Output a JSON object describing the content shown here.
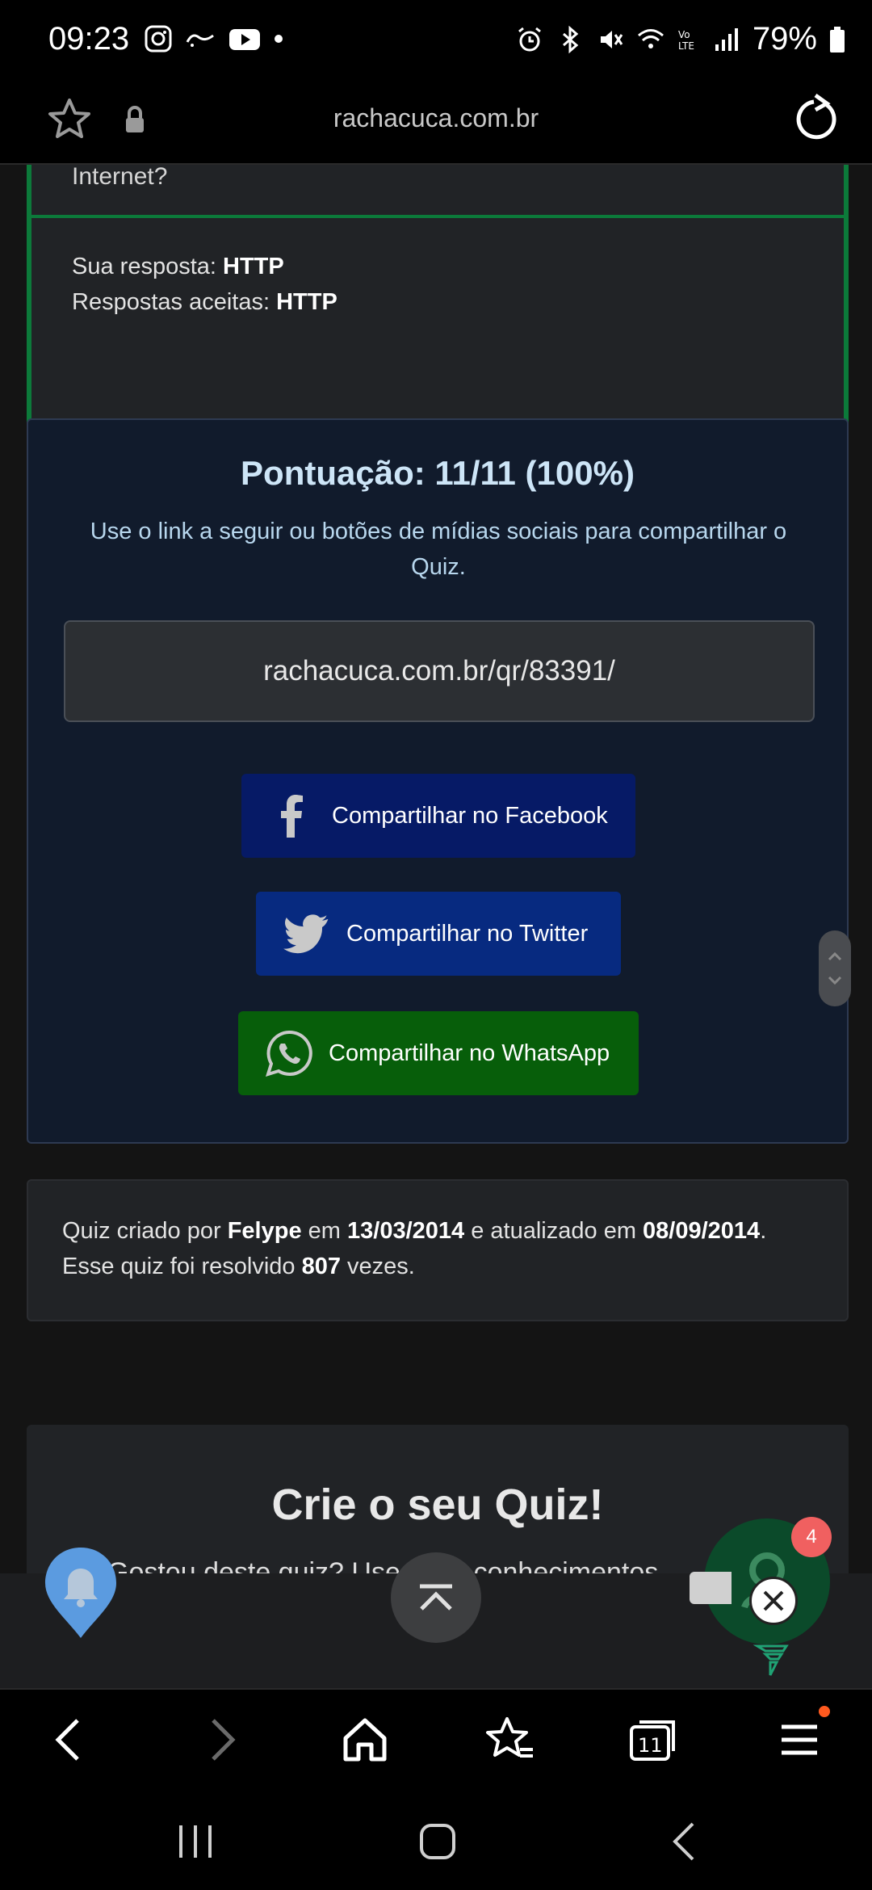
{
  "status_bar": {
    "time": "09:23",
    "battery": "79%",
    "left_icons": [
      "instagram-icon",
      "ifood-icon",
      "youtube-icon",
      "dot-icon"
    ],
    "right_icons": [
      "alarm-icon",
      "bluetooth-icon",
      "mute-icon",
      "wifi-icon",
      "volte-icon",
      "signal-icon",
      "battery-icon"
    ]
  },
  "url_bar": {
    "domain": "rachacuca.com.br"
  },
  "answer": {
    "cut_text": "Internet?",
    "your_answer_label": "Sua resposta:",
    "your_answer_value": "HTTP",
    "accepted_label": "Respostas aceitas:",
    "accepted_value": "HTTP"
  },
  "score": {
    "title": "Pontuação: 11/11 (100%)",
    "description": "Use o link a seguir ou botões de mídias sociais para compartilhar o Quiz.",
    "share_link": "rachacuca.com.br/qr/83391/",
    "facebook_label": "Compartilhar no Facebook",
    "twitter_label": "Compartilhar no Twitter",
    "whatsapp_label": "Compartilhar no WhatsApp"
  },
  "quiz_info": {
    "created_by_prefix": "Quiz criado por",
    "author": "Felype",
    "created_on_prefix": "em",
    "created_date": "13/03/2014",
    "updated_prefix": "e atualizado em",
    "updated_date": "08/09/2014",
    "period": ".",
    "solved_prefix": "Esse quiz foi resolvido",
    "solved_count": "807",
    "solved_suffix": "vezes."
  },
  "create_quiz": {
    "title": "Crie o seu Quiz!",
    "subtitle": "Gostou deste quiz? Use seus conhecimentos"
  },
  "floating": {
    "chat_badge": "4"
  },
  "colors": {
    "answer_border": "#0c7a3a",
    "facebook": "#061a66",
    "twitter": "#072a80",
    "whatsapp": "#075e0a",
    "score_title": "#cde5f7",
    "menu_dot": "#ff5a1f"
  }
}
